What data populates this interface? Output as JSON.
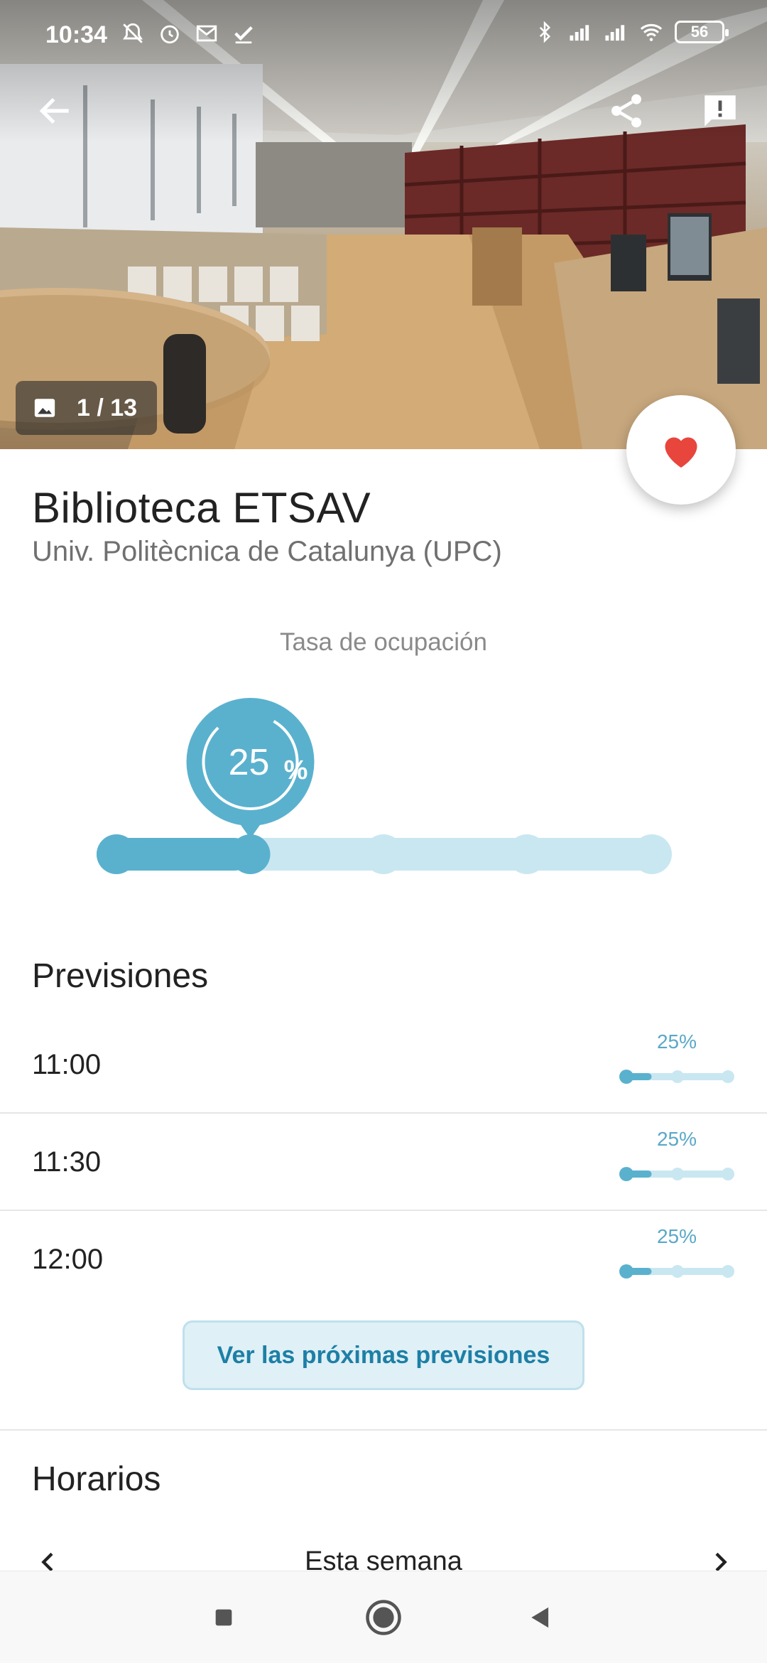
{
  "status_bar": {
    "time": "10:34",
    "left_icons": [
      "muted-bell-icon",
      "alarm-icon",
      "gmail-icon",
      "check-icon"
    ],
    "right_icons": [
      "bluetooth-icon",
      "signal-roaming-icon",
      "signal-icon",
      "wifi-icon"
    ],
    "battery": "56"
  },
  "toolbar": {
    "back_icon": "arrow-back-icon",
    "share_icon": "share-icon",
    "report_icon": "report-icon"
  },
  "gallery": {
    "counter": "1 / 13",
    "counter_icon": "image-icon"
  },
  "favorite": {
    "icon": "heart-icon",
    "color": "#e8453c"
  },
  "place": {
    "name": "Biblioteca ETSAV",
    "institution": "Univ. Politècnica de Catalunya (UPC)"
  },
  "occupancy": {
    "label": "Tasa de ocupación",
    "value": "25",
    "unit": "%",
    "level_fraction": 0.25,
    "color": "#5ab1ce",
    "track_color": "#c9e7f1"
  },
  "forecasts": {
    "title": "Previsiones",
    "rows": [
      {
        "time": "11:00",
        "pct": "25%",
        "level_fraction": 0.25
      },
      {
        "time": "11:30",
        "pct": "25%",
        "level_fraction": 0.25
      },
      {
        "time": "12:00",
        "pct": "25%",
        "level_fraction": 0.25
      }
    ],
    "more_button": "Ver las próximas previsiones"
  },
  "schedule": {
    "title": "Horarios",
    "week_label": "Esta semana"
  },
  "nav_bar": {
    "icons": [
      "recent-apps-icon",
      "home-icon",
      "back-icon"
    ]
  }
}
